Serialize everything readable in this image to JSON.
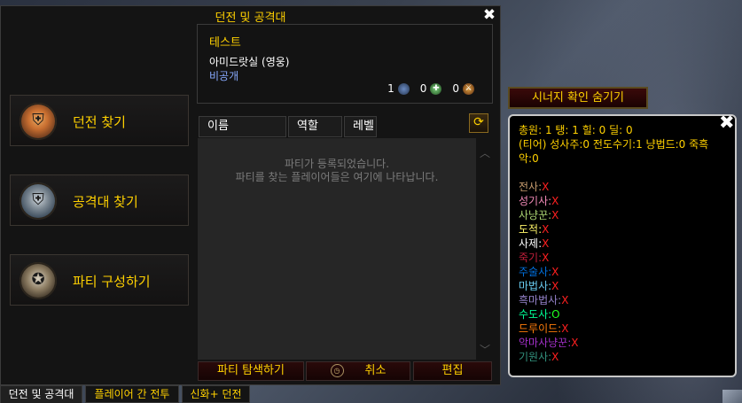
{
  "window": {
    "title": "던전 및 공격대",
    "close_glyph": "✖"
  },
  "roles": [
    {
      "label": "던전 찾기",
      "icon": "dungeon-helm-icon"
    },
    {
      "label": "공격대 찾기",
      "icon": "raid-helm-icon"
    },
    {
      "label": "파티 구성하기",
      "icon": "premade-group-icon"
    }
  ],
  "group": {
    "title": "테스트",
    "activity": "아미드랏실 (영웅)",
    "privacy": "비공개",
    "tank_count": "1",
    "healer_count": "0",
    "dps_count": "0"
  },
  "columns": [
    "이름",
    "역할",
    "레벨"
  ],
  "list": {
    "empty_line1": "파티가 등록되었습니다.",
    "empty_line2": "파티를 찾는 플레이어들은 여기에 나타납니다."
  },
  "actions": {
    "browse": "파티 탐색하기",
    "cancel": "취소",
    "edit": "편집"
  },
  "tabs": [
    "던전 및 공격대",
    "플레이어 간 전투",
    "신화+ 던전"
  ],
  "synergy": {
    "toggle_label": "시너지 확인 숨기기",
    "summary": "총원: 1  탱: 1  힐: 0  딜: 0",
    "tiers": "(티어) 성사주:0 전도수기:1 냥법드:0 죽흑악:0",
    "classes": [
      {
        "name": "전사",
        "mark": "X",
        "color": "#c79c6e"
      },
      {
        "name": "성기사",
        "mark": "X",
        "color": "#f58cba"
      },
      {
        "name": "사냥꾼",
        "mark": "X",
        "color": "#abd473"
      },
      {
        "name": "도적",
        "mark": "X",
        "color": "#fff569"
      },
      {
        "name": "사제",
        "mark": "X",
        "color": "#ffffff"
      },
      {
        "name": "죽기",
        "mark": "X",
        "color": "#c41f3b"
      },
      {
        "name": "주술사",
        "mark": "X",
        "color": "#0070de"
      },
      {
        "name": "마법사",
        "mark": "X",
        "color": "#69ccf0"
      },
      {
        "name": "흑마법사",
        "mark": "X",
        "color": "#9482c9"
      },
      {
        "name": "수도사",
        "mark": "O",
        "color": "#00ff96"
      },
      {
        "name": "드루이드",
        "mark": "X",
        "color": "#ff7d0a"
      },
      {
        "name": "악마사냥꾼",
        "mark": "X",
        "color": "#a330c9"
      },
      {
        "name": "기원사",
        "mark": "X",
        "color": "#33937f"
      }
    ]
  }
}
